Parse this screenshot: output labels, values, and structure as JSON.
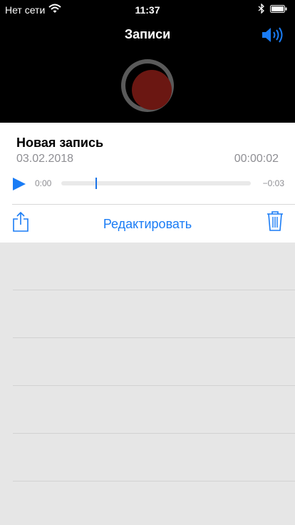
{
  "status_bar": {
    "carrier": "Нет сети",
    "time": "11:37"
  },
  "header": {
    "title": "Записи"
  },
  "recording": {
    "name": "Новая запись",
    "date": "03.02.2018",
    "duration": "00:00:02",
    "current_time": "0:00",
    "remaining_time": "−0:03",
    "progress_fraction": 0.18
  },
  "actions": {
    "edit_label": "Редактировать"
  },
  "colors": {
    "accent": "#1a7cf5",
    "record_red": "#6b1712",
    "background": "#e6e6e6"
  },
  "icons": [
    "wifi-icon",
    "bluetooth-icon",
    "battery-icon",
    "speaker-icon",
    "record-icon",
    "play-icon",
    "share-icon",
    "trash-icon"
  ]
}
